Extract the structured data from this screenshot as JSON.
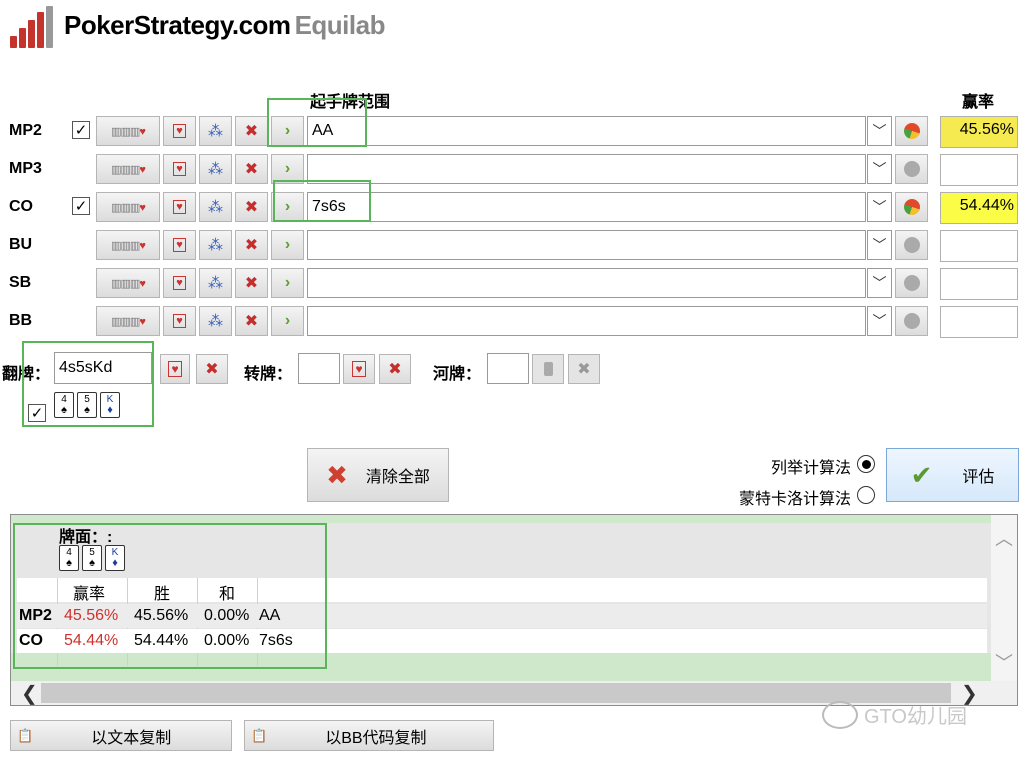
{
  "logo": {
    "name": "PokerStrategy.com",
    "suffix": "Equilab"
  },
  "headers": {
    "range": "起手牌范围",
    "equity": "赢率"
  },
  "players": [
    {
      "pos": "MP2",
      "checked": true,
      "range": "AA",
      "equity": "45.56%"
    },
    {
      "pos": "MP3",
      "checked": false,
      "range": "",
      "equity": ""
    },
    {
      "pos": "CO",
      "checked": true,
      "range": "7s6s",
      "equity": "54.44%"
    },
    {
      "pos": "BU",
      "checked": false,
      "range": "",
      "equity": ""
    },
    {
      "pos": "SB",
      "checked": false,
      "range": "",
      "equity": ""
    },
    {
      "pos": "BB",
      "checked": false,
      "range": "",
      "equity": ""
    }
  ],
  "board": {
    "flop_label": "翻牌：",
    "flop_value": "4s5sKd",
    "turn_label": "转牌：",
    "turn_value": "",
    "river_label": "河牌：",
    "river_value": "",
    "cards": [
      {
        "rank": "4",
        "suit": "♠"
      },
      {
        "rank": "5",
        "suit": "♠"
      },
      {
        "rank": "K",
        "suit": "♦"
      }
    ]
  },
  "actions": {
    "clear_all": "清除全部",
    "enum_algo": "列举计算法",
    "monte_algo": "蒙特卡洛计算法",
    "evaluate": "评估"
  },
  "results": {
    "board_label": "牌面：:",
    "cols": {
      "equity": "赢率",
      "win": "胜",
      "tie": "和"
    },
    "rows": [
      {
        "pos": "MP2",
        "equity": "45.56%",
        "win": "45.56%",
        "tie": "0.00%",
        "hand": "AA"
      },
      {
        "pos": "CO",
        "equity": "54.44%",
        "win": "54.44%",
        "tie": "0.00%",
        "hand": "7s6s"
      }
    ]
  },
  "copy": {
    "text": "以文本复制",
    "bb": "以BB代码复制"
  },
  "watermark": "GTO幼儿园",
  "colors": {
    "equity_yellow": "#f5eb50",
    "green_band": "#cfe8cc",
    "highlight_green": "#5ab45a",
    "red_text": "#d0312d"
  }
}
